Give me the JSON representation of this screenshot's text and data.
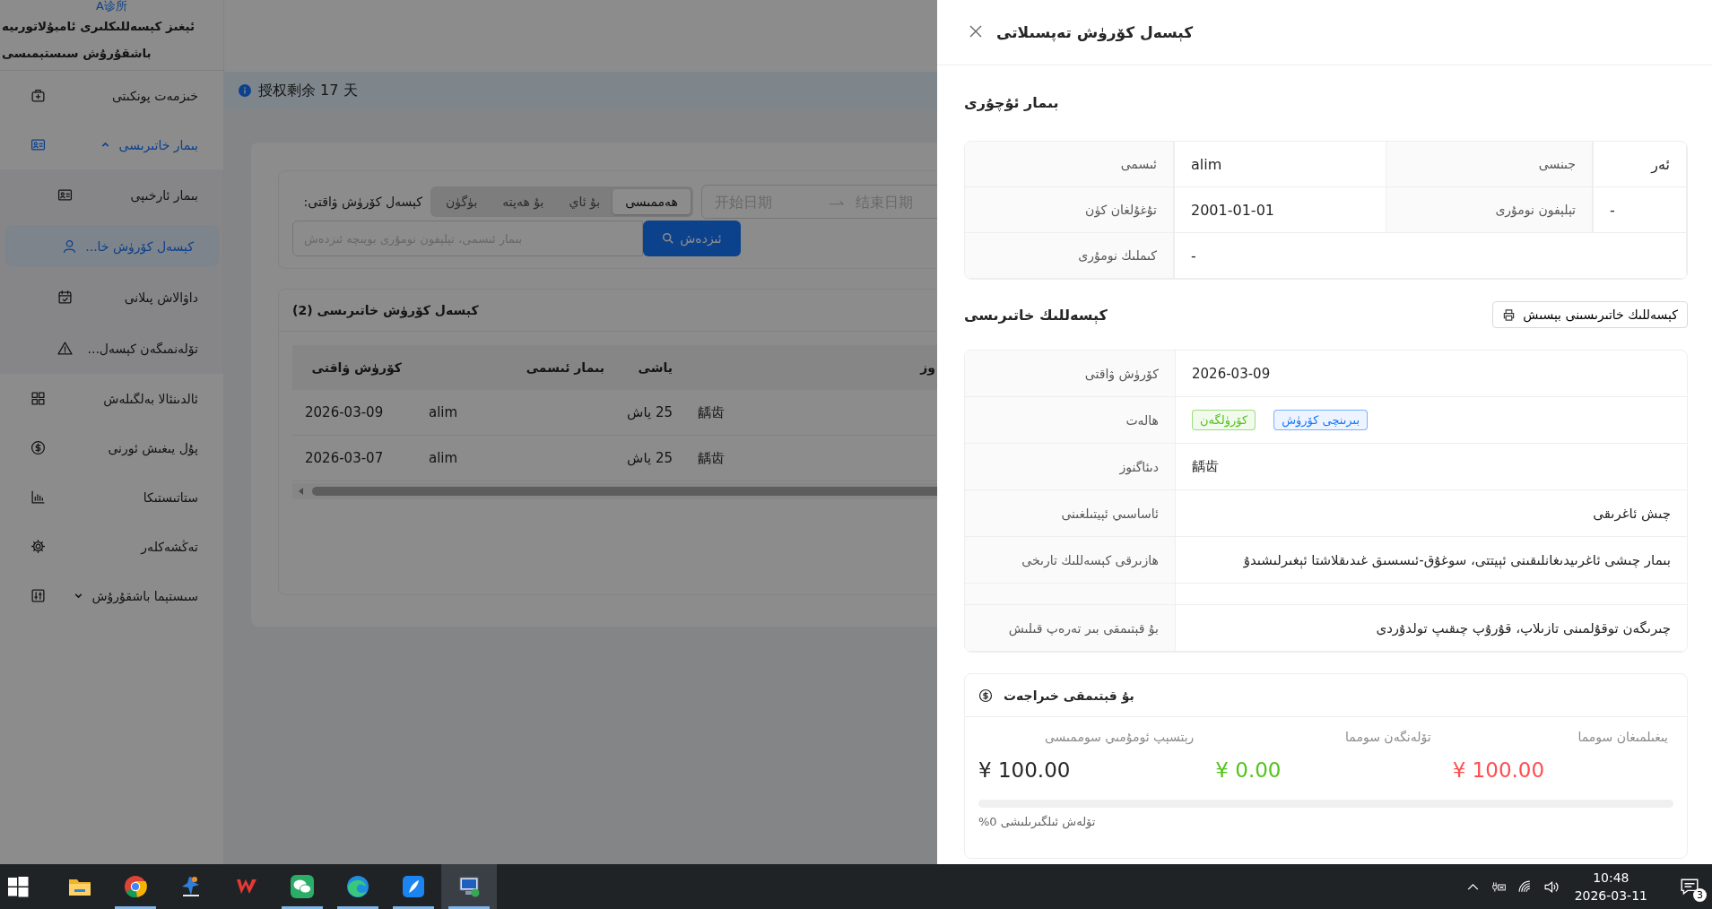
{
  "sidebar": {
    "clinic": "A诊所",
    "title": "ئېغىز كېسەللىكلىرى ئامبۇلاتورىيە باشقۇرۇش سىستېمىسى",
    "items": [
      {
        "label": "خىزمەت پونكىتى",
        "selected": false
      },
      {
        "label": "بىمار خاتىرىسى",
        "selected": false,
        "expanded": true,
        "children": [
          {
            "label": "بىمار ئارخىپى",
            "selected": false
          },
          {
            "label": "كېسەل كۆرۈش خا...",
            "selected": true
          },
          {
            "label": "داۋالاش پىلانى",
            "selected": false
          },
          {
            "label": "تۆلەنمىگەن كېسەل...",
            "selected": false
          }
        ]
      },
      {
        "label": "ئالدىنئالا بەلگىلەش",
        "selected": false
      },
      {
        "label": "پۇل يىغىش ئورنى",
        "selected": false
      },
      {
        "label": "ستاتىستىكا",
        "selected": false
      },
      {
        "label": "تەڭشەكلەر",
        "selected": false
      },
      {
        "label": "سىستېما باشقۇرۇش",
        "selected": false,
        "expanded": false
      }
    ]
  },
  "alert": {
    "text": "授权剩余 17 天"
  },
  "filter": {
    "label": "كېسەل كۆرۈش ۋاقتى:",
    "periods": [
      {
        "label": "ھەممىسى",
        "selected": true
      },
      {
        "label": "بۇ ئاي",
        "selected": false
      },
      {
        "label": "بۇ ھەپتە",
        "selected": false
      },
      {
        "label": "بۈگۈن",
        "selected": false
      }
    ],
    "date_start": {
      "placeholder": "开始日期"
    },
    "date_end": {
      "placeholder": "结束日期"
    },
    "search": {
      "placeholder": "بىمار ئىسمى، تېلېفون نومۇرى بويىچە ئىزدەش"
    },
    "search_button": "ئىزدەش"
  },
  "visits": {
    "title": "كېسەل كۆرۈش خاتىرىسى (2)",
    "columns": [
      "وز",
      "ياشى",
      "بىمار ئىسمى",
      "كۆرۈش ۋاقتى"
    ],
    "rows": [
      [
        "龋齿",
        "25 ياش",
        "alim",
        "2026-03-09"
      ],
      [
        "龋齿",
        "25 ياش",
        "alim",
        "2026-03-07"
      ]
    ]
  },
  "drawer": {
    "title": "كېسەل كۆرۈش تەپسىلاتى",
    "patient": {
      "title": "بىمار ئۇچۇرى",
      "fields": [
        {
          "label": "جىنسى",
          "value": "ئەر"
        },
        {
          "label": "ئىسمى",
          "value": "alim"
        },
        {
          "label": "تېلېفون نومۇرى",
          "value": "-"
        },
        {
          "label": "تۇغۇلغان كۈن",
          "value": "2001-01-01"
        },
        {
          "label": "كىملىك نومۇرى",
          "value": "-"
        }
      ]
    },
    "record": {
      "title": "كېسەللىك خاتىرىسى",
      "print_button": "كېسەللىك خاتىرىسىنى بېسىش",
      "fields": [
        {
          "kind": "text",
          "label": "كۆرۈش ۋاقتى",
          "value": "2026-03-09"
        },
        {
          "kind": "tags",
          "label": "ھالەت",
          "tags": [
            {
              "text": "بىرىنچى كۆرۈش",
              "color": "#1677ff"
            },
            {
              "text": "كۆرۈلگەن",
              "color": "#52c41a"
            }
          ]
        },
        {
          "kind": "text",
          "label": "دىئاگنوز",
          "value": "龋齿"
        },
        {
          "kind": "text",
          "label": "ئاساسىي ئېيتىلغىنى",
          "value": "چىش ئاغرىقى"
        },
        {
          "kind": "text",
          "label": "ھازىرقى كېسەللىك تارىخى",
          "value": "بىمار چىشى ئاغرىيدىغانلىقىنى ئېيتتى، سوغۇق-ئىسسىق غىدىقلاشتا ئېغىرلىشىدۇ"
        },
        {
          "kind": "blank"
        },
        {
          "kind": "text",
          "label": "بۇ قېتىمقى بىر تەرەپ قىلىش",
          "value": "چىرىگەن توقۇلمىنى تازىلاپ، قۇرۇپ چىقىپ تولدۇردى"
        }
      ]
    },
    "fees": {
      "title": "بۇ قېتىمقى خىراجەت",
      "items": [
        {
          "label": "يىغىلمىغان سومما",
          "amount": "¥ 100.00",
          "color": "#ff4d4f"
        },
        {
          "label": "تۆلەنگەن سومما",
          "amount": "¥ 0.00",
          "color": "#52c41a"
        },
        {
          "label": "رېتسېپ ئومۇمىي سوممىسى",
          "amount": "¥ 100.00",
          "color": "#262626"
        }
      ],
      "progress": {
        "level": 0,
        "label": "تۆلەش ئىلگىرىلىشى 0%"
      }
    }
  },
  "taskbar": {
    "apps": [
      {
        "kind": "folder",
        "running": false,
        "selected": false
      },
      {
        "kind": "browser",
        "running": true,
        "selected": false
      },
      {
        "kind": "medical",
        "running": false,
        "selected": false
      },
      {
        "kind": "office",
        "running": false,
        "selected": false
      },
      {
        "kind": "chat",
        "running": true,
        "selected": false
      },
      {
        "kind": "edge",
        "running": true,
        "selected": false
      },
      {
        "kind": "feather",
        "running": true,
        "selected": false
      },
      {
        "kind": "remote",
        "running": true,
        "selected": true
      }
    ],
    "time": "10:48",
    "date": "2026-03-11",
    "notifications": "3"
  }
}
